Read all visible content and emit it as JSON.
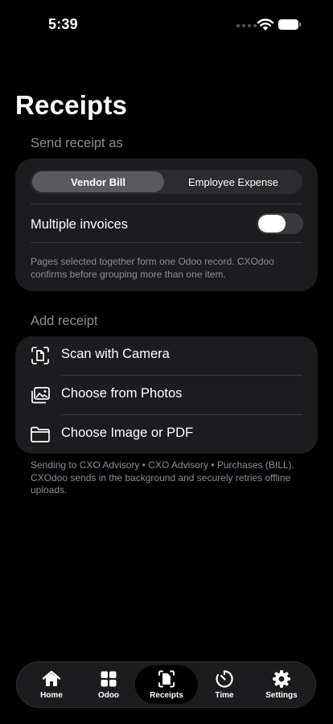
{
  "status": {
    "time": "5:39"
  },
  "page": {
    "title": "Receipts"
  },
  "send_section": {
    "header": "Send receipt as",
    "options": [
      "Vendor Bill",
      "Employee Expense"
    ],
    "selected": "Vendor Bill",
    "multiple_invoices_label": "Multiple invoices",
    "multiple_invoices_on": false,
    "note": "Pages selected together form one Odoo record. CXOdoo confirms before grouping more than one item."
  },
  "add_section": {
    "header": "Add receipt",
    "actions": [
      {
        "label": "Scan with Camera",
        "icon": "document-scan-icon"
      },
      {
        "label": "Choose from Photos",
        "icon": "photos-icon"
      },
      {
        "label": "Choose Image or PDF",
        "icon": "folder-icon"
      }
    ],
    "footer": "Sending to CXO Advisory • CXO Advisory • Purchases (BILL). CXOdoo sends in the background and securely retries offline uploads."
  },
  "tabs": [
    {
      "label": "Home",
      "icon": "house-icon"
    },
    {
      "label": "Odoo",
      "icon": "grid-icon"
    },
    {
      "label": "Receipts",
      "icon": "receipt-scan-icon",
      "active": true
    },
    {
      "label": "Time",
      "icon": "timer-icon"
    },
    {
      "label": "Settings",
      "icon": "gear-icon"
    }
  ]
}
